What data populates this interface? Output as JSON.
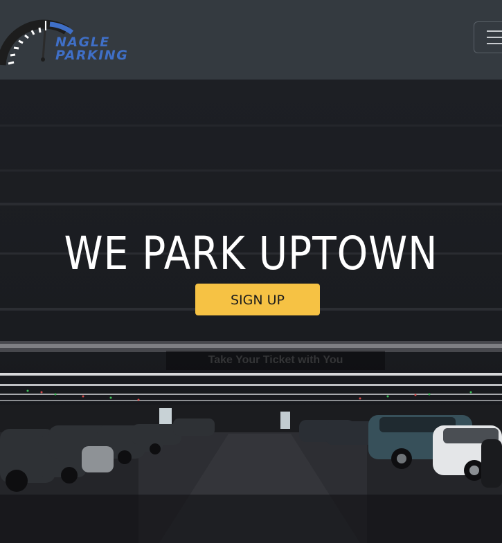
{
  "brand": {
    "line1": "NAGLE",
    "line2": "PARKING",
    "logo_icon": "speedometer-icon",
    "accent_color": "#3f6fc7"
  },
  "nav": {
    "menu_icon": "hamburger-icon"
  },
  "hero": {
    "headline": "WE PARK UPTOWN",
    "cta_label": "SIGN UP",
    "cta_color": "#f6c244",
    "note": "Take Your Ticket with You"
  }
}
